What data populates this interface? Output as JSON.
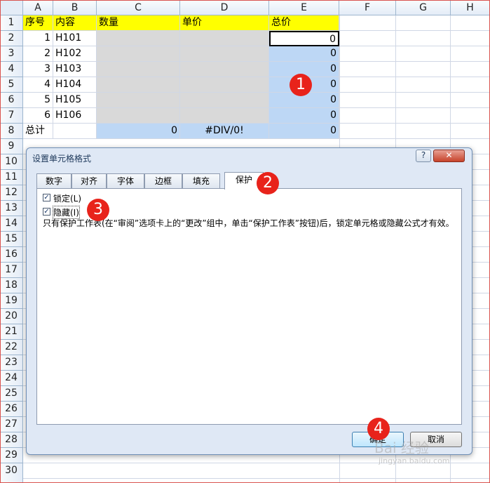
{
  "sheet": {
    "columns": [
      "A",
      "B",
      "C",
      "D",
      "E",
      "F",
      "G",
      "H"
    ],
    "rows": [
      "1",
      "2",
      "3",
      "4",
      "5",
      "6",
      "7",
      "8",
      "9",
      "10",
      "11",
      "12",
      "13",
      "14",
      "15",
      "16",
      "17",
      "18",
      "19",
      "20",
      "21",
      "22",
      "23",
      "24",
      "25",
      "26",
      "27",
      "28",
      "29",
      "30"
    ],
    "headers": {
      "seq": "序号",
      "content": "内容",
      "qty": "数量",
      "price": "单价",
      "total": "总价"
    },
    "items": [
      {
        "seq": "1",
        "content": "H101",
        "total": "0"
      },
      {
        "seq": "2",
        "content": "H102",
        "total": "0"
      },
      {
        "seq": "3",
        "content": "H103",
        "total": "0"
      },
      {
        "seq": "4",
        "content": "H104",
        "total": "0"
      },
      {
        "seq": "5",
        "content": "H105",
        "total": "0"
      },
      {
        "seq": "6",
        "content": "H106",
        "total": "0"
      }
    ],
    "summary": {
      "label": "总计",
      "qty": "0",
      "price": "#DIV/0!",
      "total": "0"
    },
    "colors": {
      "header": "#ffff00",
      "locked_gray": "#d9d9d9",
      "formula_blue": "#bdd7f5"
    }
  },
  "dialog": {
    "title": "设置单元格格式",
    "help_button": "?",
    "close_button": "✕",
    "tabs": [
      "数字",
      "对齐",
      "字体",
      "边框",
      "填充",
      "保护"
    ],
    "active_tab": "保护",
    "lock_label": "锁定(L)",
    "hide_label": "隐藏(I)",
    "note": "只有保护工作表(在“审阅”选项卡上的“更改”组中，单击“保护工作表”按钮)后，锁定单元格或隐藏公式才有效。",
    "ok_button": "确定",
    "cancel_button": "取消"
  },
  "badges": [
    "1",
    "2",
    "3",
    "4"
  ],
  "watermark": {
    "logo": "Bai 经验",
    "url": "jingyan.baidu.com"
  }
}
